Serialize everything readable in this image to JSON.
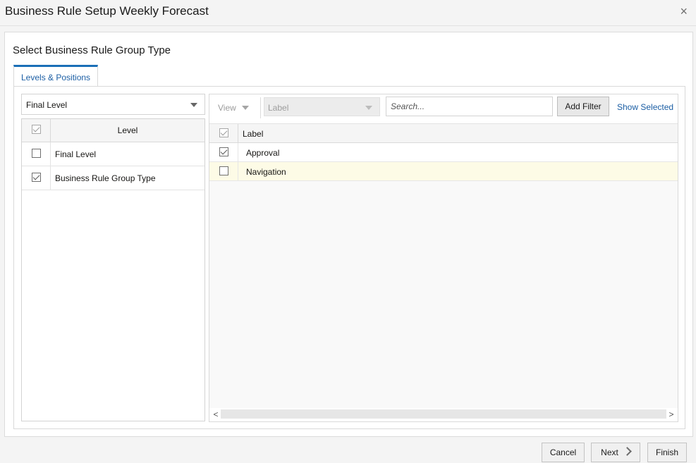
{
  "dialog": {
    "title": "Business Rule Setup Weekly Forecast",
    "close_glyph": "×"
  },
  "wizard": {
    "subtitle": "Select Business Rule Group Type",
    "tab_label": "Levels & Positions"
  },
  "left": {
    "dropdown_value": "Final Level",
    "column_header": "Level",
    "header_checked": true,
    "rows": [
      {
        "label": "Final Level",
        "checked": false
      },
      {
        "label": "Business Rule Group Type",
        "checked": true
      }
    ]
  },
  "right": {
    "view_label": "View",
    "label_dropdown": "Label",
    "search_placeholder": "Search...",
    "add_filter": "Add Filter",
    "show_selected": "Show Selected",
    "column_header": "Label",
    "header_checked": true,
    "rows": [
      {
        "label": "Approval",
        "checked": true
      },
      {
        "label": "Navigation",
        "checked": false
      }
    ],
    "scroll_left": "<",
    "scroll_right": ">"
  },
  "footer": {
    "cancel": "Cancel",
    "next": "Next",
    "finish": "Finish"
  },
  "colors": {
    "accent": "#1b6fb7",
    "link": "#1b5ea4",
    "highlight_row": "#fdfbe6"
  }
}
